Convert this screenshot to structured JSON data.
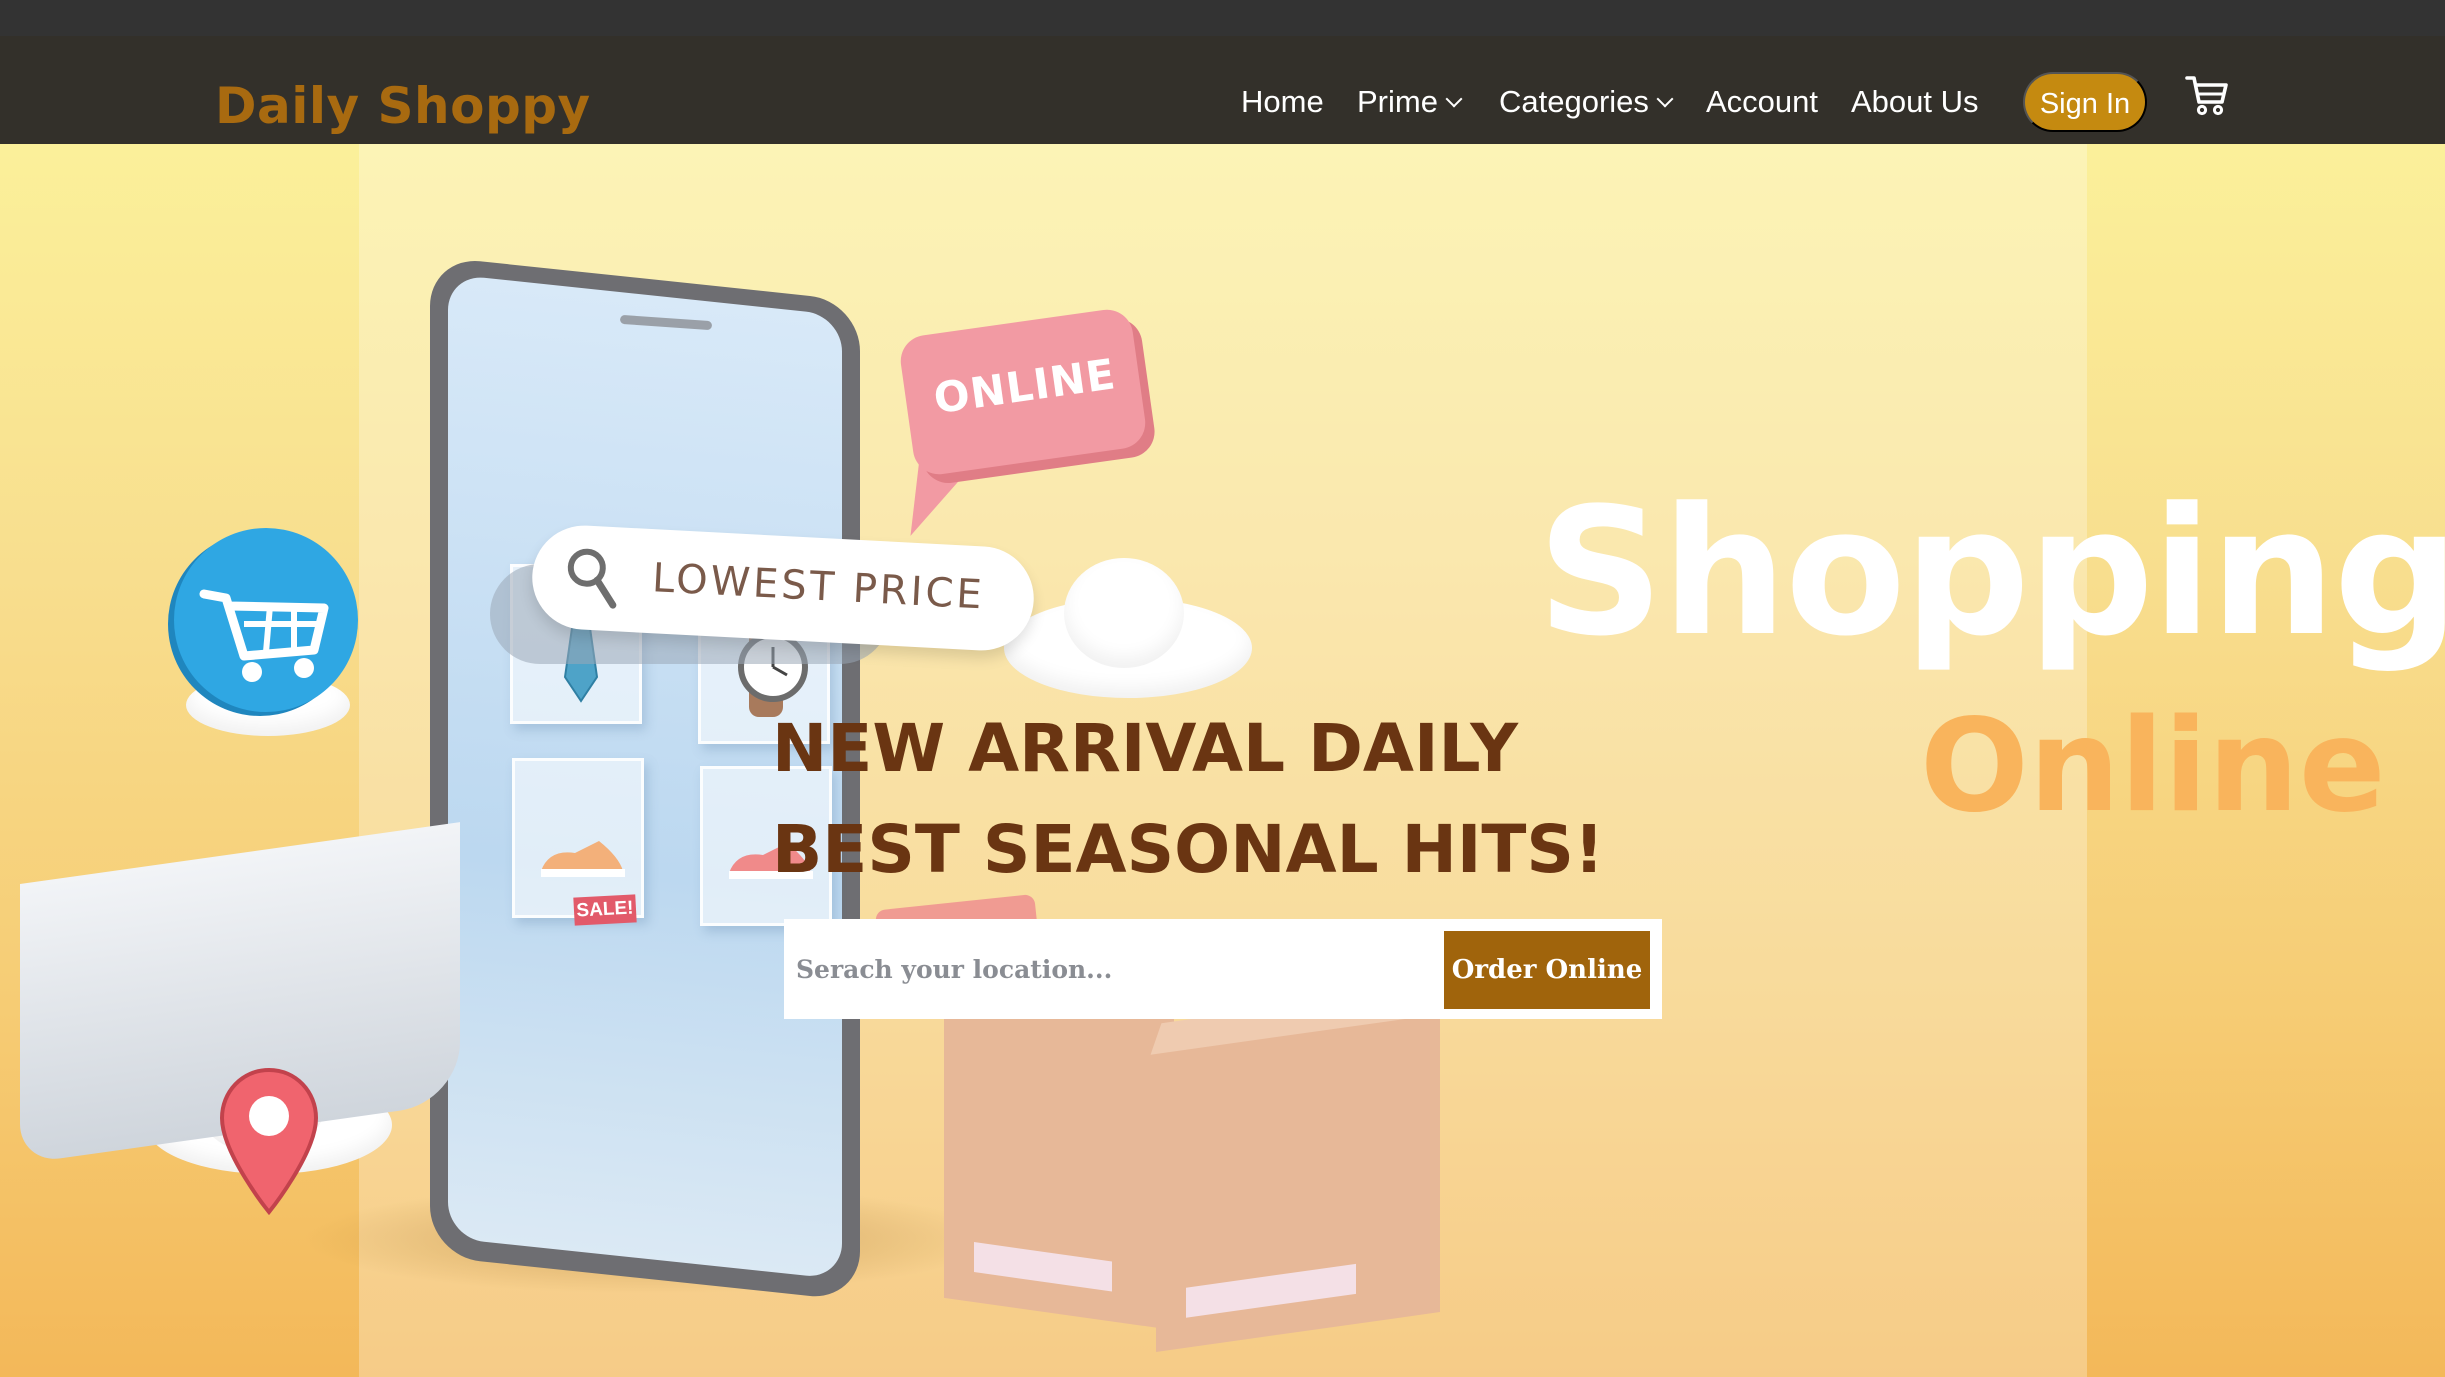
{
  "header": {
    "brand": "Daily Shoppy",
    "nav": [
      {
        "label": "Home"
      },
      {
        "label": "Prime"
      },
      {
        "label": "Categories"
      },
      {
        "label": "Account"
      },
      {
        "label": "About Us"
      }
    ],
    "sign_in_label": "Sign In",
    "cart_icon": "shopping-cart-icon"
  },
  "hero": {
    "illustration": {
      "search_text": "LOWEST PRICE",
      "bubble_text": "ONLINE",
      "sale_tag": "SALE!"
    },
    "title_big": "Shopping",
    "title_sub": "Online",
    "headline_line1": "NEW ARRIVAL DAILY",
    "headline_line2": "BEST SEASONAL HITS!",
    "location_placeholder": "Serach your location...",
    "order_button_label": "Order Online"
  },
  "colors": {
    "brand": "#a86a10",
    "nav_bg": "#33302a",
    "sign_in_bg": "#c58a10",
    "headline": "#6a3512",
    "order_button_bg": "#a0640c",
    "online_accent": "#f9b45c"
  }
}
